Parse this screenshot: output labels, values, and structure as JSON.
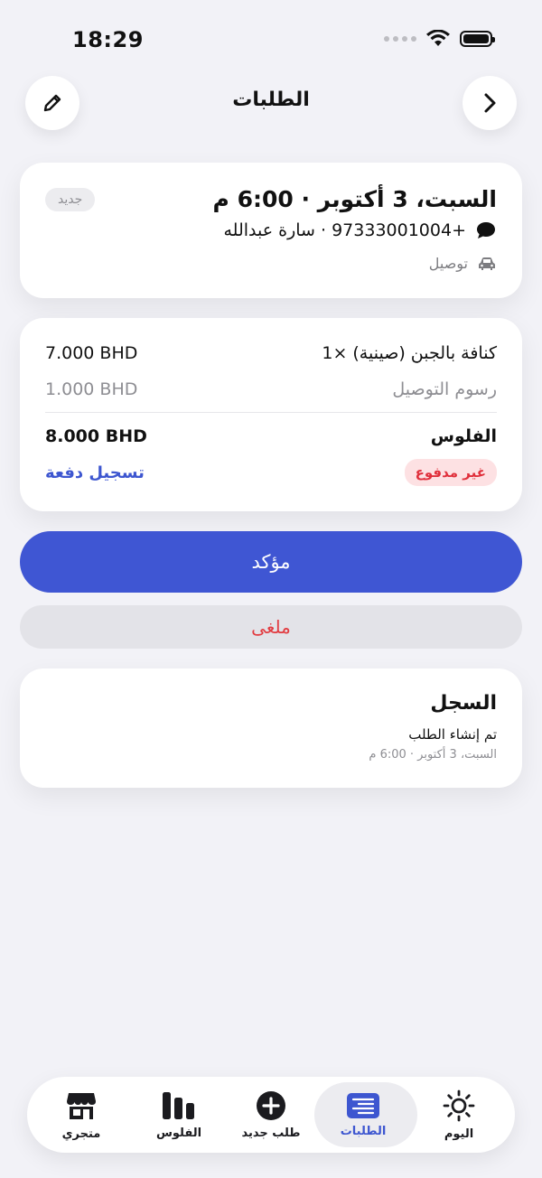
{
  "status_bar": {
    "time": "18:29"
  },
  "header": {
    "title": "الطلبات"
  },
  "order": {
    "status_badge": "جديد",
    "date": "السبت، 3 أكتوبر · 6:00 م",
    "contact": "+97333001004 · سارة عبدالله",
    "delivery": "توصيل"
  },
  "items": {
    "line1_name": "كنافة بالجبن (صينية) ×1",
    "line1_price": "7.000 BHD",
    "fee_label": "رسوم التوصيل",
    "fee_price": "1.000 BHD",
    "total_label": "الفلوس",
    "total_price": "8.000 BHD",
    "payment_status": "غير مدفوع",
    "record_payment": "تسجيل دفعة"
  },
  "actions": {
    "confirm": "مؤكد",
    "cancel": "ملغى"
  },
  "log": {
    "title": "السجل",
    "event": "تم إنشاء الطلب",
    "time": "السبت، 3 أكتوبر · 6:00 م"
  },
  "tabs": {
    "store": "متجري",
    "money": "الفلوس",
    "new_order": "طلب جديد",
    "orders": "الطلبات",
    "today": "اليوم"
  },
  "colors": {
    "accent": "#3f56d3",
    "danger": "#e23b40",
    "background": "#f2f2f7"
  }
}
